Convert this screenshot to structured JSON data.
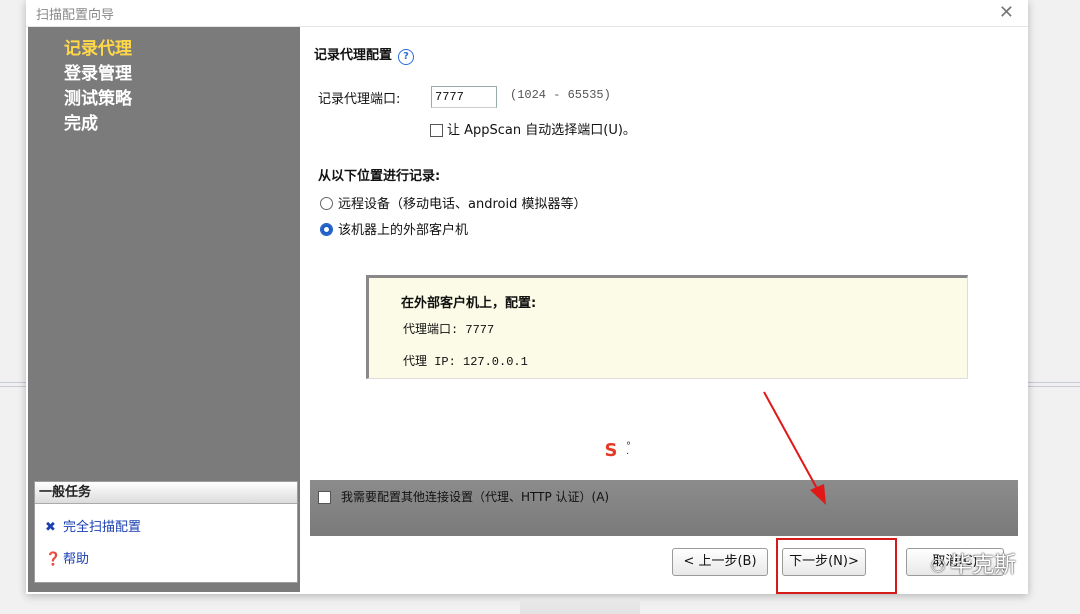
{
  "window": {
    "title": "扫描配置向导"
  },
  "nav": [
    {
      "label": "记录代理",
      "active": true
    },
    {
      "label": "登录管理",
      "active": false
    },
    {
      "label": "测试策略",
      "active": false
    },
    {
      "label": "完成",
      "active": false
    }
  ],
  "tasks": {
    "header": "一般任务",
    "items": [
      {
        "label": "完全扫描配置",
        "icon": "wrench-icon"
      },
      {
        "label": "帮助",
        "icon": "help-icon"
      }
    ]
  },
  "section": {
    "title": "记录代理配置",
    "port_label": "记录代理端口:",
    "port_value": "7777",
    "port_range": "(1024 - 65535)",
    "auto_port_label": "让 AppScan 自动选择端口(U)。",
    "auto_port_checked": false,
    "record_from_title": "从以下位置进行记录:",
    "radio_remote": "远程设备（移动电话、android 模拟器等）",
    "radio_local": "该机器上的外部客户机",
    "selected_radio": "local"
  },
  "info": {
    "title": "在外部客户机上，配置:",
    "proxy_port": "代理端口: 7777",
    "proxy_ip": "代理 IP: 127.0.0.1"
  },
  "options": {
    "other_conn_label": "我需要配置其他连接设置（代理、HTTP 认证）(A)",
    "other_conn_checked": false
  },
  "buttons": {
    "prev": "< 上一步(B)",
    "next": "下一步(N)>",
    "cancel": "取消(C)"
  },
  "watermark": "毕克斯",
  "colors": {
    "sidebar": "#7b7b7b",
    "nav_active": "#ffd84a",
    "highlight": "#d61a1a"
  }
}
